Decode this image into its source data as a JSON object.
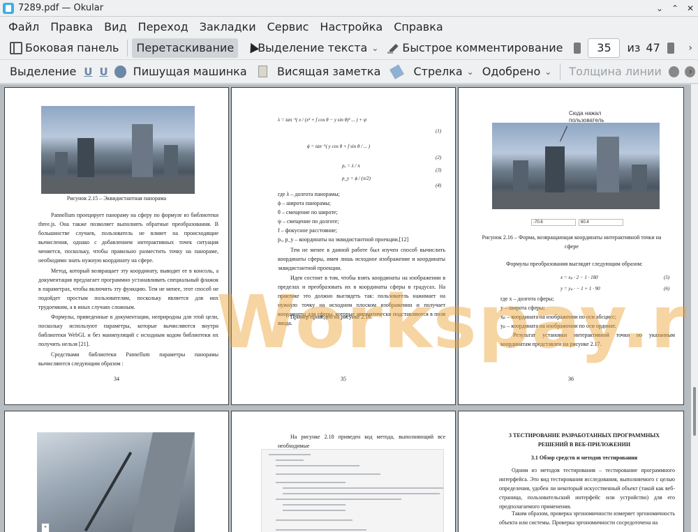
{
  "window": {
    "title": "7289.pdf — Okular",
    "controls": [
      "⌄",
      "⌃",
      "✕"
    ]
  },
  "menu": [
    "Файл",
    "Правка",
    "Вид",
    "Переход",
    "Закладки",
    "Сервис",
    "Настройка",
    "Справка"
  ],
  "toolbar1": {
    "sidebar_label": "Боковая панель",
    "drag_label": "Перетаскивание",
    "text_select_label": "Выделение текста",
    "quick_comment_label": "Быстрое комментирование",
    "current_page": "35",
    "of_label": "из",
    "total_pages": "47"
  },
  "toolbar2": {
    "select_label": "Выделение",
    "typewriter_label": "Пишущая машинка",
    "sticky_note_label": "Висящая заметка",
    "arrow_label": "Стрелка",
    "approved_label": "Одобрено",
    "line_width_label": "Толщина линии"
  },
  "pages": {
    "p34": {
      "caption": "Рисунок 2.15 – Эквидистантная панорама",
      "para1": "Pannellum проецирует панораму на сферу по формуле из библиотеки three.js. Она также позволяет выполнять обратные преобразования. В большинстве случаев, пользователь не влияет на происходящие вычисления, однако с добавлением интерактивных точек ситуация меняется, поскольку, чтобы правильно разместить точку на панораме, необходимо знать нужную координату на сфере.",
      "para2": "Метод, который возвращает эту координату, выводит ее в консоль, а документация предлагает программно устанавливать специальный флажок в параметрах, чтобы включить эту функцию. Тем не менее, этот способ не подойдет простым пользователям, поскольку является для них трудоемким, а в иных случаях сложным.",
      "para3": "Формулы, приведенные в документации, неприродны для этой цели, поскольку используют параметры, которые вычисляются внутри библиотеки WebGL и без манипуляций с исходным кодом библиотеки их получить нельзя [21].",
      "para4": "Средствами библиотеки Pannellum параметры панорамы вычисляются следующим образом :",
      "number": "34"
    },
    "p35": {
      "f1": "λ = tan⁻¹( x / (x² + f cos θ − y sin θ)² ... ) + ψ",
      "f1n": "(1)",
      "f2": "ϕ = tan⁻¹( y cos θ + f sin θ / ... )",
      "f2n": "(2)",
      "f3": "pₓ = λ / π",
      "f3n": "(3)",
      "f4": "p_y = ϕ / (π/2)",
      "f4n": "(4)",
      "defs": [
        "где λ – долгота панорамы;",
        "ϕ – широта панорамы;",
        "θ – смещение по широте;",
        "ψ – смещение по долготе;",
        "f – фокусное расстояние;",
        "pₓ, p_y – координаты на эквидистантной проекции.[12]"
      ],
      "para1": "Тем не менее в данной работе был изучен способ вычислить координаты сферы, имея лишь исходное изображение и координаты эквидистантной проекции.",
      "para2": "Идея состоит в том, чтобы взять координаты на изображении в пределах и преобразовать их в координаты сферы в градусах. На практике это должно выглядеть так: пользователь нажимает на нужную точку на исходном плоском изображении и получает координаты для сферы, которые автоматически подставляются в поля ввода.",
      "para3": "Пример приведен на рисунке 2.16.",
      "number": "35"
    },
    "p36": {
      "callout": "Сюда нажал пользователь",
      "input1": "-70.6",
      "input2": "60.4",
      "caption": "Рисунок 2.16 – Форма, возвращающая координаты интерактивной точки на сфере",
      "intro": "Формулы преобразования выглядят следующим образом:",
      "f5": "x = xₚ · 2 − 1 · 180",
      "f5n": "(5)",
      "f6": "y = yₚ · − 1 + 1 · 90",
      "f6n": "(6)",
      "defs": [
        "где x – долгота сферы;",
        "y – широта сферы;",
        "xₚ – координата на изображении по оси абсцисс;",
        "yₚ – координата на изображении по оси ординат."
      ],
      "result": "Результат установки интерактивной точки по указанным координатам представлен на рисунке 2.17.",
      "number": "36"
    },
    "p38": {
      "intro": "На рисунке 2.18 приведен код метода, выполняющий все необходимые"
    },
    "p39": {
      "heading": "3 ТЕСТИРОВАНИЕ РАЗРАБОТАННЫХ ПРОГРАММНЫХ РЕШЕНИЙ В ВЕБ-ПРИЛОЖЕНИИ",
      "subheading": "3.1 Обзор средств и методов тестирования",
      "para1": "Одним из методов тестирования – тестирование программного интерфейса. Это вид тестирования исследования, выполняемого с целью определения, удобен ли некоторый искусственный объект (такой как веб-страница, пользовательский интерфейс или устройство) для его предполагаемого применения.",
      "para2": "Таким образом, проверка эргономичности измеряет эргономичность объекта или системы. Проверка эргономичности сосредоточена на"
    }
  },
  "watermark": "Workspay.ru"
}
